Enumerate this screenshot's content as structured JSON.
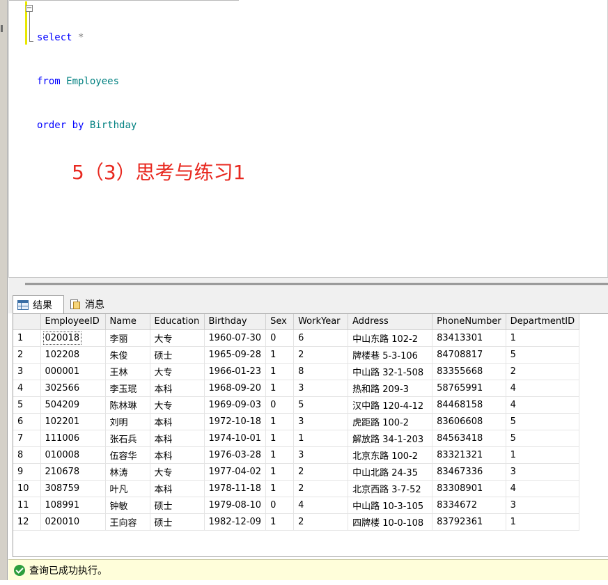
{
  "editor": {
    "code_lines": [
      {
        "kw": "select",
        "rest": " *"
      },
      {
        "kw": "from",
        "obj": " Employees"
      },
      {
        "kw": "order by",
        "obj": " Birthday"
      }
    ],
    "annotation": "5（3）思考与练习1"
  },
  "results_tabs": {
    "results_label": "结果",
    "messages_label": "消息"
  },
  "grid": {
    "columns": [
      "EmployeeID",
      "Name",
      "Education",
      "Birthday",
      "Sex",
      "WorkYear",
      "Address",
      "PhoneNumber",
      "DepartmentID"
    ],
    "rows": [
      [
        "1",
        "020018",
        "李丽",
        "大专",
        "1960-07-30",
        "0",
        "6",
        "中山东路 102-2",
        "83413301",
        "1"
      ],
      [
        "2",
        "102208",
        "朱俊",
        "硕士",
        "1965-09-28",
        "1",
        "2",
        "牌楼巷 5-3-106",
        "84708817",
        "5"
      ],
      [
        "3",
        "000001",
        "王林",
        "大专",
        "1966-01-23",
        "1",
        "8",
        "中山路 32-1-508",
        "83355668",
        "2"
      ],
      [
        "4",
        "302566",
        "李玉珉",
        "本科",
        "1968-09-20",
        "1",
        "3",
        "热和路 209-3",
        "58765991",
        "4"
      ],
      [
        "5",
        "504209",
        "陈林琳",
        "大专",
        "1969-09-03",
        "0",
        "5",
        "汉中路 120-4-12",
        "84468158",
        "4"
      ],
      [
        "6",
        "102201",
        "刘明",
        "本科",
        "1972-10-18",
        "1",
        "3",
        "虎距路 100-2",
        "83606608",
        "5"
      ],
      [
        "7",
        "111006",
        "张石兵",
        "本科",
        "1974-10-01",
        "1",
        "1",
        "解放路 34-1-203",
        "84563418",
        "5"
      ],
      [
        "8",
        "010008",
        "伍容华",
        "本科",
        "1976-03-28",
        "1",
        "3",
        "北京东路 100-2",
        "83321321",
        "1"
      ],
      [
        "9",
        "210678",
        "林涛",
        "大专",
        "1977-04-02",
        "1",
        "2",
        "中山北路 24-35",
        "83467336",
        "3"
      ],
      [
        "10",
        "308759",
        "叶凡",
        "本科",
        "1978-11-18",
        "1",
        "2",
        "北京西路 3-7-52",
        "83308901",
        "4"
      ],
      [
        "11",
        "108991",
        "钟敏",
        "硕士",
        "1979-08-10",
        "0",
        "4",
        "中山路 10-3-105",
        "8334672",
        "3"
      ],
      [
        "12",
        "020010",
        "王向容",
        "硕士",
        "1982-12-09",
        "1",
        "2",
        "四牌楼 10-0-108",
        "83792361",
        "1"
      ]
    ]
  },
  "status": {
    "text": "查询已成功执行。",
    "color": "#fffeda"
  }
}
